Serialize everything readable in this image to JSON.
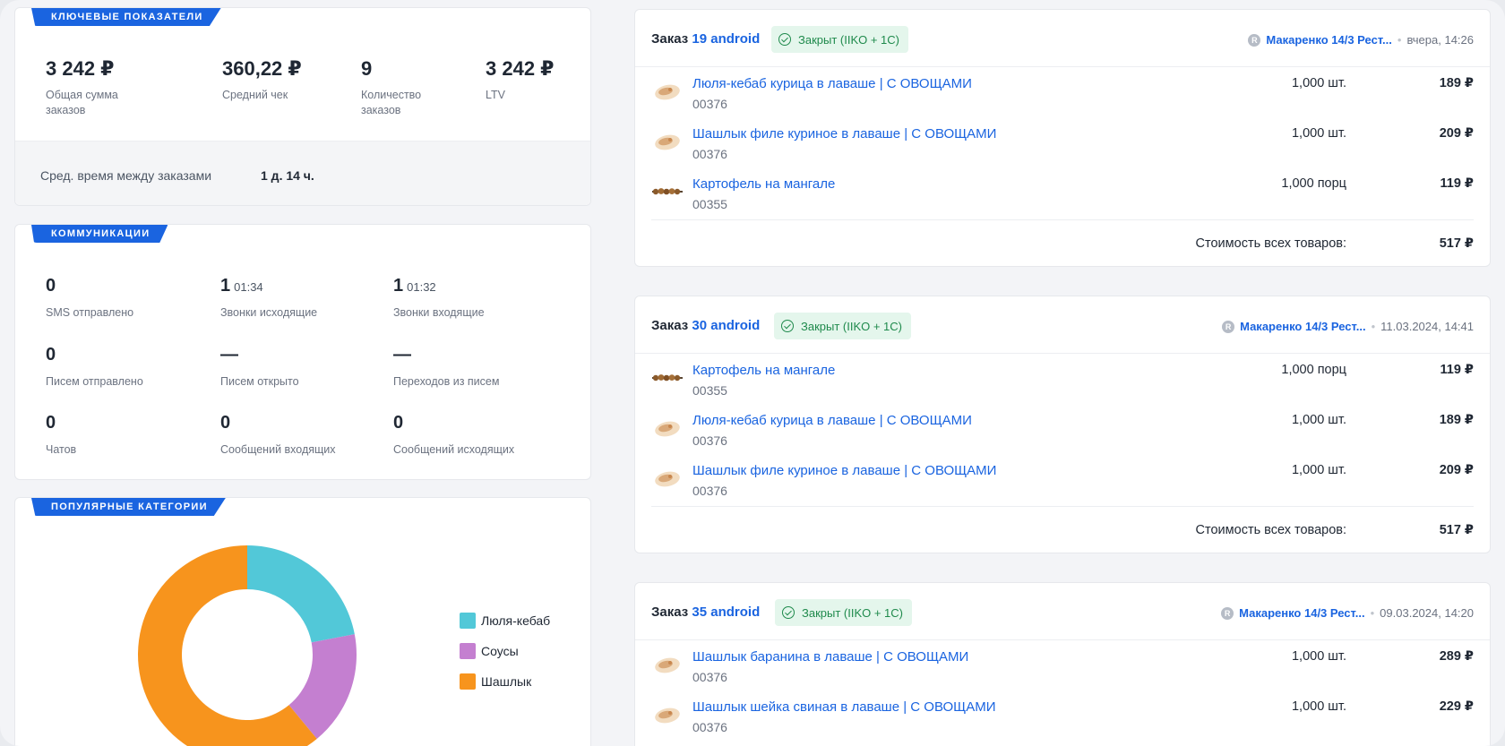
{
  "kpi": {
    "tag": "КЛЮЧЕВЫЕ ПОКАЗАТЕЛИ",
    "items": [
      {
        "value": "3 242 ₽",
        "label": "Общая сумма заказов"
      },
      {
        "value": "360,22 ₽",
        "label": "Средний чек"
      },
      {
        "value": "9",
        "label": "Количество заказов"
      },
      {
        "value": "3 242 ₽",
        "label": "LTV"
      }
    ],
    "avg_label": "Сред. время между заказами",
    "avg_value": "1 д. 14 ч."
  },
  "communications": {
    "tag": "КОММУНИКАЦИИ",
    "items": [
      {
        "value": "0",
        "sub": "",
        "label": "SMS отправлено"
      },
      {
        "value": "1",
        "sub": "01:34",
        "label": "Звонки исходящие"
      },
      {
        "value": "1",
        "sub": "01:32",
        "label": "Звонки входящие"
      },
      {
        "value": "0",
        "sub": "",
        "label": "Писем отправлено"
      },
      {
        "value": "—",
        "sub": "",
        "label": "Писем открыто"
      },
      {
        "value": "—",
        "sub": "",
        "label": "Переходов из писем"
      },
      {
        "value": "0",
        "sub": "",
        "label": "Чатов"
      },
      {
        "value": "0",
        "sub": "",
        "label": "Сообщений входящих"
      },
      {
        "value": "0",
        "sub": "",
        "label": "Сообщений исходящих"
      }
    ]
  },
  "categories": {
    "tag": "ПОПУЛЯРНЫЕ КАТЕГОРИИ"
  },
  "chart_data": {
    "type": "pie",
    "title": "",
    "categories": [
      "Люля-кебаб",
      "Соусы",
      "Шашлык"
    ],
    "values": [
      22,
      17,
      61
    ],
    "colors": [
      "#52c8d8",
      "#c47fd0",
      "#f7941d"
    ],
    "legend": "right",
    "donut": true
  },
  "orders": [
    {
      "title_prefix": "Заказ",
      "number": "19 android",
      "status": "Закрыт (IIKO + 1C)",
      "shop_icon_letter": "R",
      "shop": "Макаренко 14/3 Рест...",
      "date": "вчера, 14:26",
      "items": [
        {
          "thumb": "kebab",
          "name": "Люля-кебаб курица в лаваше | С ОВОЩАМИ",
          "code": "00376",
          "qty": "1,000 шт.",
          "price": "189 ₽"
        },
        {
          "thumb": "kebab",
          "name": "Шашлык филе куриное в лаваше | С ОВОЩАМИ",
          "code": "00376",
          "qty": "1,000 шт.",
          "price": "209 ₽"
        },
        {
          "thumb": "potato",
          "name": "Картофель на мангале",
          "code": "00355",
          "qty": "1,000 порц",
          "price": "119 ₽"
        }
      ],
      "total_label": "Стоимость всех товаров:",
      "total": "517 ₽"
    },
    {
      "title_prefix": "Заказ",
      "number": "30 android",
      "status": "Закрыт (IIKO + 1C)",
      "shop_icon_letter": "R",
      "shop": "Макаренко 14/3 Рест...",
      "date": "11.03.2024, 14:41",
      "items": [
        {
          "thumb": "potato",
          "name": "Картофель на мангале",
          "code": "00355",
          "qty": "1,000 порц",
          "price": "119 ₽"
        },
        {
          "thumb": "kebab",
          "name": "Люля-кебаб курица в лаваше | С ОВОЩАМИ",
          "code": "00376",
          "qty": "1,000 шт.",
          "price": "189 ₽"
        },
        {
          "thumb": "kebab",
          "name": "Шашлык филе куриное в лаваше | С ОВОЩАМИ",
          "code": "00376",
          "qty": "1,000 шт.",
          "price": "209 ₽"
        }
      ],
      "total_label": "Стоимость всех товаров:",
      "total": "517 ₽"
    },
    {
      "title_prefix": "Заказ",
      "number": "35 android",
      "status": "Закрыт (IIKO + 1C)",
      "shop_icon_letter": "R",
      "shop": "Макаренко 14/3 Рест...",
      "date": "09.03.2024, 14:20",
      "items": [
        {
          "thumb": "kebab",
          "name": "Шашлык баранина в лаваше | С ОВОЩАМИ",
          "code": "00376",
          "qty": "1,000 шт.",
          "price": "289 ₽"
        },
        {
          "thumb": "kebab",
          "name": "Шашлык шейка свиная в лаваше | С ОВОЩАМИ",
          "code": "00376",
          "qty": "1,000 шт.",
          "price": "229 ₽"
        }
      ],
      "total_label": "",
      "total": ""
    }
  ]
}
